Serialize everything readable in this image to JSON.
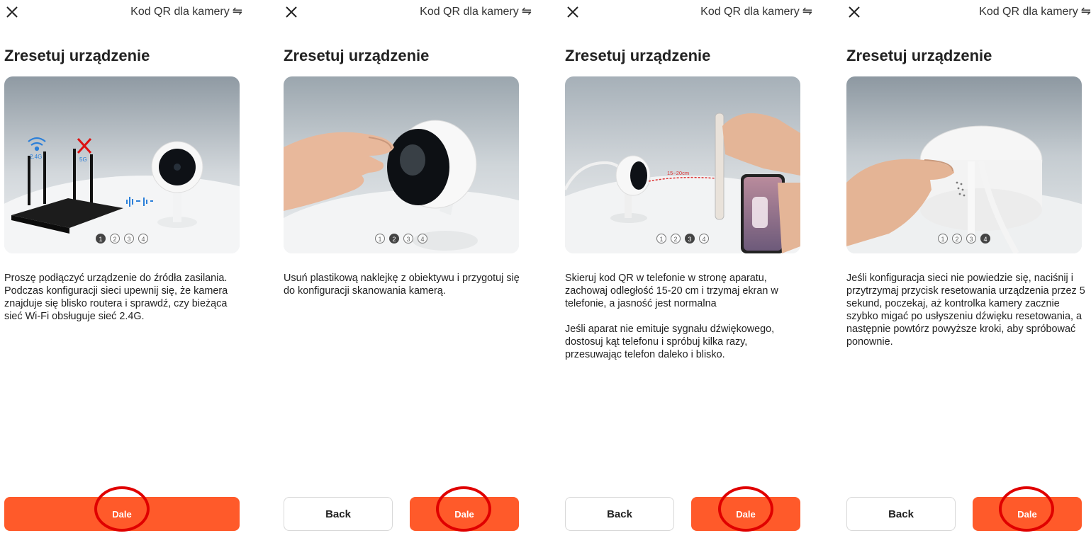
{
  "header": {
    "qr_link_label": "Kod QR dla kamery",
    "swap_icon": "swap-arrows-icon",
    "close_icon": "close-icon"
  },
  "colors": {
    "accent": "#ff5a2a",
    "annotation": "#e00000"
  },
  "panels": [
    {
      "title": "Zresetuj urządzenie",
      "image_labels": {
        "wifi_24": "2.4G",
        "wifi_5": "5G"
      },
      "step": 1,
      "steps": [
        "1",
        "2",
        "3",
        "4"
      ],
      "description": [
        "Proszę podłączyć urządzenie do źródła zasilania. Podczas konfiguracji sieci upewnij się, że kamera znajduje się blisko routera i sprawdź, czy bieżąca sieć Wi-Fi obsługuje sieć 2.4G."
      ],
      "next_label": "Dale"
    },
    {
      "title": "Zresetuj urządzenie",
      "step": 2,
      "steps": [
        "1",
        "2",
        "3",
        "4"
      ],
      "description": [
        "Usuń plastikową naklejkę z obiektywu i przygotuj się do konfiguracji skanowania kamerą."
      ],
      "back_label": "Back",
      "next_label": "Dale"
    },
    {
      "title": "Zresetuj urządzenie",
      "image_labels": {
        "distance": "15~20cm"
      },
      "step": 3,
      "steps": [
        "1",
        "2",
        "3",
        "4"
      ],
      "description": [
        "Skieruj kod QR w telefonie w stronę aparatu, zachowaj odległość 15-20 cm i trzymaj ekran w telefonie, a jasność jest normalna",
        "Jeśli aparat nie emituje sygnału dźwiękowego, dostosuj kąt telefonu i spróbuj kilka razy, przesuwając telefon daleko i blisko."
      ],
      "back_label": "Back",
      "next_label": "Dale"
    },
    {
      "title": "Zresetuj urządzenie",
      "step": 4,
      "steps": [
        "1",
        "2",
        "3",
        "4"
      ],
      "description": [
        "Jeśli konfiguracja sieci nie powiedzie się, naciśnij i przytrzymaj przycisk resetowania urządzenia przez 5 sekund, poczekaj, aż kontrolka kamery zacznie szybko migać po usłyszeniu dźwięku resetowania, a następnie powtórz powyższe kroki, aby spróbować ponownie."
      ],
      "back_label": "Back",
      "next_label": "Dale"
    }
  ]
}
